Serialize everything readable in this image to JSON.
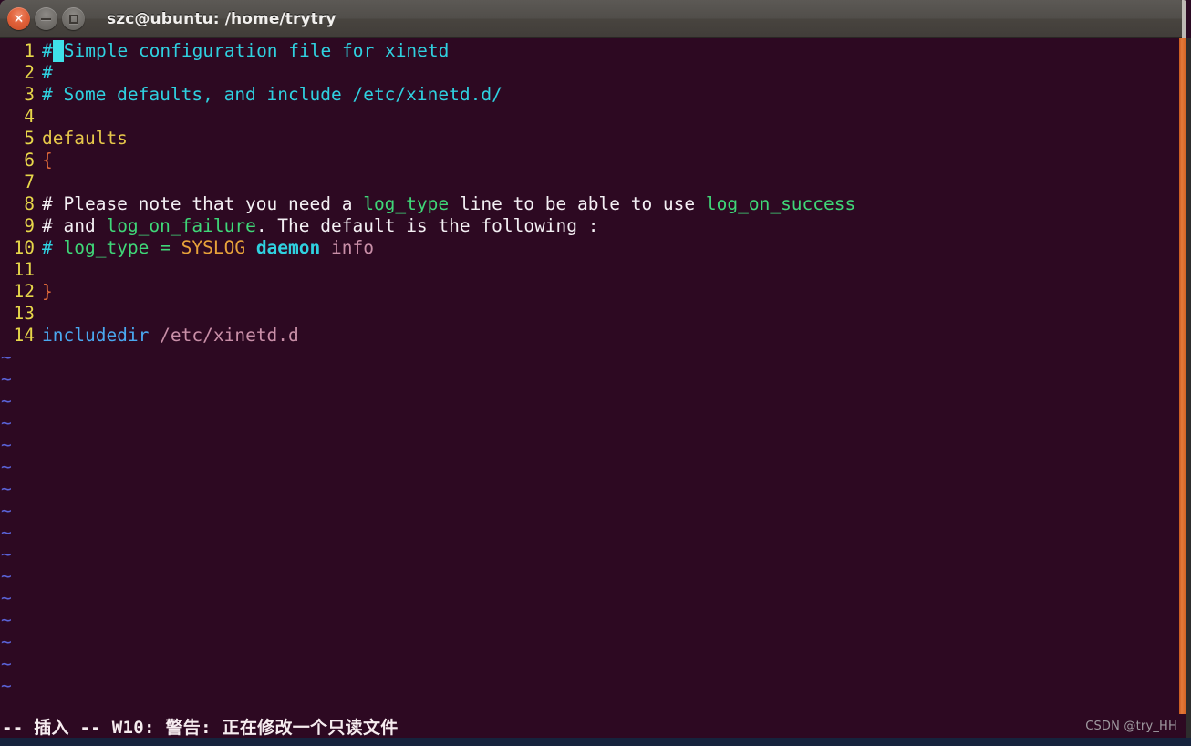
{
  "window": {
    "title": "szc@ubuntu: /home/trytry",
    "controls": [
      {
        "name": "close",
        "glyph": "×"
      },
      {
        "name": "minimize",
        "glyph": "−"
      },
      {
        "name": "maximize",
        "glyph": "□"
      }
    ]
  },
  "theme": {
    "background": "#2d0922",
    "titlebar": "#4e4a46",
    "line_number": "#e7d74a",
    "comment": "#2fd1e0",
    "keyword": "#3fd778",
    "identifier": "#4aa8f0",
    "string": "#c98fa8",
    "cursor": "#3fe0e8",
    "scrollbar": "#d0601f",
    "tilde": "#5a63d8"
  },
  "editor": {
    "filetype": "xinetd configuration",
    "lines": [
      {
        "num": "1",
        "segments": [
          {
            "t": "#",
            "c": "c-comment"
          },
          {
            "t": " ",
            "c": "cursor"
          },
          {
            "t": "Simple configuration file for xinetd",
            "c": "c-comment"
          }
        ]
      },
      {
        "num": "2",
        "segments": [
          {
            "t": "#",
            "c": "c-comment"
          }
        ]
      },
      {
        "num": "3",
        "segments": [
          {
            "t": "# Some defaults, and include /etc/xinetd.d/",
            "c": "c-comment"
          }
        ]
      },
      {
        "num": "4",
        "segments": []
      },
      {
        "num": "5",
        "segments": [
          {
            "t": "defaults",
            "c": "c-yellow"
          }
        ]
      },
      {
        "num": "6",
        "segments": [
          {
            "t": "{",
            "c": "c-orange"
          }
        ]
      },
      {
        "num": "7",
        "segments": []
      },
      {
        "num": "8",
        "segments": [
          {
            "t": "# Please note that you need a ",
            "c": "c-white"
          },
          {
            "t": "log_type",
            "c": "c-keyword"
          },
          {
            "t": " line to be able to use ",
            "c": "c-white"
          },
          {
            "t": "log_on_success",
            "c": "c-keyword"
          }
        ]
      },
      {
        "num": "9",
        "segments": [
          {
            "t": "# and ",
            "c": "c-white"
          },
          {
            "t": "log_on_failure",
            "c": "c-keyword"
          },
          {
            "t": ". The default is the following :",
            "c": "c-white"
          }
        ]
      },
      {
        "num": "10",
        "segments": [
          {
            "t": "# ",
            "c": "c-comment"
          },
          {
            "t": "log_type = ",
            "c": "c-keyword"
          },
          {
            "t": "SYSLOG ",
            "c": "c-constant"
          },
          {
            "t": "daemon",
            "c": "c-cyanbold"
          },
          {
            "t": " ",
            "c": "c-white"
          },
          {
            "t": "info",
            "c": "c-string"
          }
        ]
      },
      {
        "num": "11",
        "segments": []
      },
      {
        "num": "12",
        "segments": [
          {
            "t": "}",
            "c": "c-orange"
          }
        ]
      },
      {
        "num": "13",
        "segments": []
      },
      {
        "num": "14",
        "segments": [
          {
            "t": "includedir",
            "c": "c-ident"
          },
          {
            "t": " ",
            "c": "c-white"
          },
          {
            "t": "/etc/xinetd.d",
            "c": "c-string"
          }
        ]
      }
    ],
    "empty_line_marker": "~",
    "empty_line_count": 16
  },
  "status": {
    "mode_and_message": "-- 插入 -- W10: 警告: 正在修改一个只读文件",
    "watermark": "CSDN @try_HH"
  }
}
